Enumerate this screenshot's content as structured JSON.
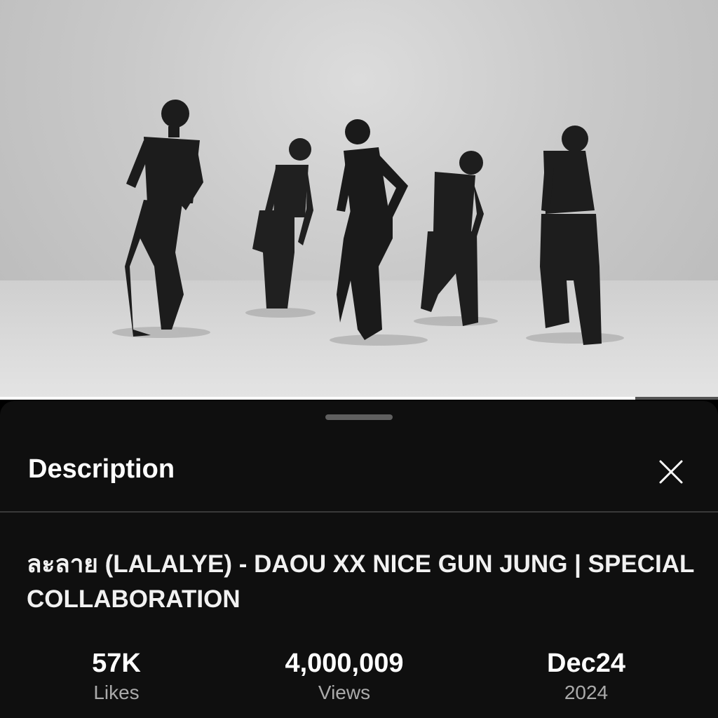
{
  "panel": {
    "title": "Description",
    "close_icon": "close-icon"
  },
  "video": {
    "title": "ละลาย (LALALYE) - DAOU XX NICE GUN JUNG | SPECIAL COLLABORATION",
    "progress": 0.885
  },
  "stats": {
    "likes": {
      "value": "57K",
      "label": "Likes"
    },
    "views": {
      "value": "4,000,009",
      "label": "Views"
    },
    "date": {
      "value": "Dec24",
      "label": "2024"
    }
  }
}
